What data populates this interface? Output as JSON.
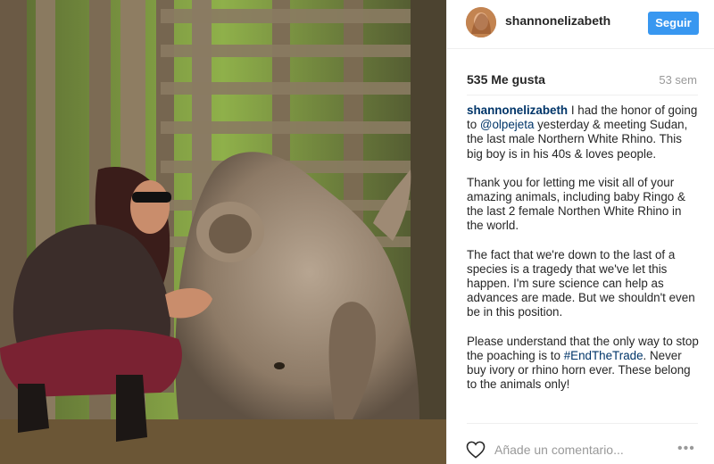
{
  "post": {
    "username": "shannonelizabeth",
    "follow_label": "Seguir",
    "likes": "535 Me gusta",
    "age": "53 sem",
    "caption": {
      "user": "shannonelizabeth",
      "p1_a": " I had the honor of going to ",
      "mention": "@olpejeta",
      "p1_b": " yesterday & meeting Sudan, the last male Northern White Rhino. This big boy is in his 40s & loves people.",
      "p2": "Thank you for letting me visit all of your amazing animals, including baby Ringo & the last 2 female Northen White Rhino in the world.",
      "p3": "The fact that we're down to the last of a species is a tragedy that we've let this happen. I'm sure science can help as advances are made. But we shouldn't even be in this position.",
      "p4_a": "Please understand that the only way to stop the poaching is to ",
      "hashtag": "#EndTheTrade",
      "p4_b": ". Never buy ivory or rhino horn ever. These belong to the animals only!"
    },
    "comment_placeholder": "Añade un comentario...",
    "more_icon": "•••"
  },
  "colors": {
    "accent": "#3897f0",
    "link": "#003569",
    "muted": "#999999"
  },
  "icons": [
    "heart-icon",
    "more-options-icon",
    "avatar"
  ]
}
